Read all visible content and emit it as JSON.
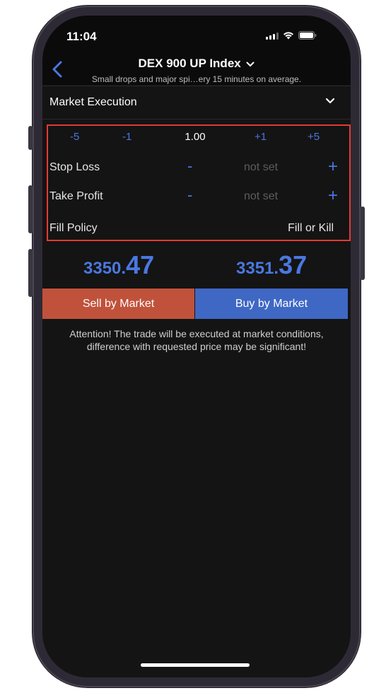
{
  "status_bar": {
    "time": "11:04"
  },
  "header": {
    "title": "DEX 900 UP Index",
    "subtitle": "Small drops and major spi…ery 15 minutes on average."
  },
  "execution": {
    "label": "Market Execution"
  },
  "volume": {
    "decrement_large": "-5",
    "decrement_small": "-1",
    "value": "1.00",
    "increment_small": "+1",
    "increment_large": "+5"
  },
  "stop_loss": {
    "label": "Stop Loss",
    "minus": "-",
    "value": "not set",
    "plus": "+"
  },
  "take_profit": {
    "label": "Take Profit",
    "minus": "-",
    "value": "not set",
    "plus": "+"
  },
  "fill_policy": {
    "label": "Fill Policy",
    "value": "Fill or Kill"
  },
  "prices": {
    "sell_main": "3350.",
    "sell_fraction": "47",
    "buy_main": "3351.",
    "buy_fraction": "37"
  },
  "actions": {
    "sell_label": "Sell by Market",
    "buy_label": "Buy by Market"
  },
  "attention": {
    "line1": "Attention! The trade will be executed at market conditions,",
    "line2": "difference with requested price may be significant!"
  },
  "colors": {
    "accent": "#4a78e0",
    "sell": "#c0523b",
    "buy": "#3f67c4",
    "highlight": "#e53935"
  },
  "icons": [
    "back-chevron-icon",
    "dropdown-chevron-icon",
    "signal-icon",
    "wifi-icon",
    "battery-icon"
  ]
}
